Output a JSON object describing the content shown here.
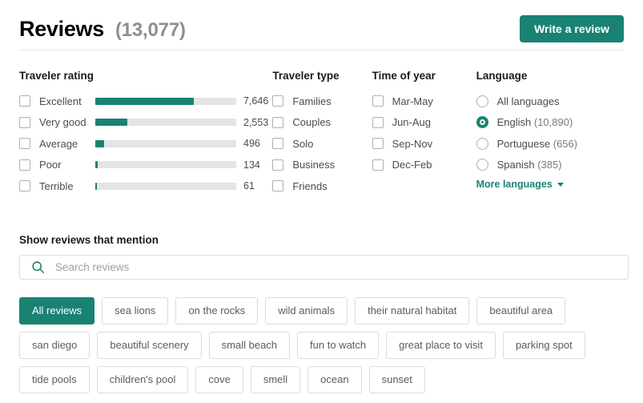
{
  "header": {
    "title": "Reviews",
    "count": "(13,077)",
    "write_review_label": "Write a review"
  },
  "filters": {
    "traveler_rating": {
      "heading": "Traveler rating",
      "bar_color": "#1A8272",
      "track_color": "#e4e4e4",
      "rows": [
        {
          "label": "Excellent",
          "count": "7,646",
          "pct": 70
        },
        {
          "label": "Very good",
          "count": "2,553",
          "pct": 23
        },
        {
          "label": "Average",
          "count": "496",
          "pct": 6
        },
        {
          "label": "Poor",
          "count": "134",
          "pct": 1.7
        },
        {
          "label": "Terrible",
          "count": "61",
          "pct": 1.2
        }
      ]
    },
    "traveler_type": {
      "heading": "Traveler type",
      "options": [
        {
          "label": "Families"
        },
        {
          "label": "Couples"
        },
        {
          "label": "Solo"
        },
        {
          "label": "Business"
        },
        {
          "label": "Friends"
        }
      ]
    },
    "time_of_year": {
      "heading": "Time of year",
      "options": [
        {
          "label": "Mar-May"
        },
        {
          "label": "Jun-Aug"
        },
        {
          "label": "Sep-Nov"
        },
        {
          "label": "Dec-Feb"
        }
      ]
    },
    "language": {
      "heading": "Language",
      "accent_color": "#1A8272",
      "options": [
        {
          "label": "All languages",
          "count": "",
          "selected": false
        },
        {
          "label": "English",
          "count": "(10,890)",
          "selected": true
        },
        {
          "label": "Portuguese",
          "count": "(656)",
          "selected": false
        },
        {
          "label": "Spanish",
          "count": "(385)",
          "selected": false
        }
      ],
      "more_label": "More languages"
    }
  },
  "mention": {
    "heading": "Show reviews that mention",
    "search": {
      "placeholder": "Search reviews",
      "value": "",
      "icon": "search-icon"
    },
    "tags": [
      {
        "label": "All reviews",
        "active": true
      },
      {
        "label": "sea lions",
        "active": false
      },
      {
        "label": "on the rocks",
        "active": false
      },
      {
        "label": "wild animals",
        "active": false
      },
      {
        "label": "their natural habitat",
        "active": false
      },
      {
        "label": "beautiful area",
        "active": false
      },
      {
        "label": "san diego",
        "active": false
      },
      {
        "label": "beautiful scenery",
        "active": false
      },
      {
        "label": "small beach",
        "active": false
      },
      {
        "label": "fun to watch",
        "active": false
      },
      {
        "label": "great place to visit",
        "active": false
      },
      {
        "label": "parking spot",
        "active": false
      },
      {
        "label": "tide pools",
        "active": false
      },
      {
        "label": "children's pool",
        "active": false
      },
      {
        "label": "cove",
        "active": false
      },
      {
        "label": "smell",
        "active": false
      },
      {
        "label": "ocean",
        "active": false
      },
      {
        "label": "sunset",
        "active": false
      }
    ]
  }
}
